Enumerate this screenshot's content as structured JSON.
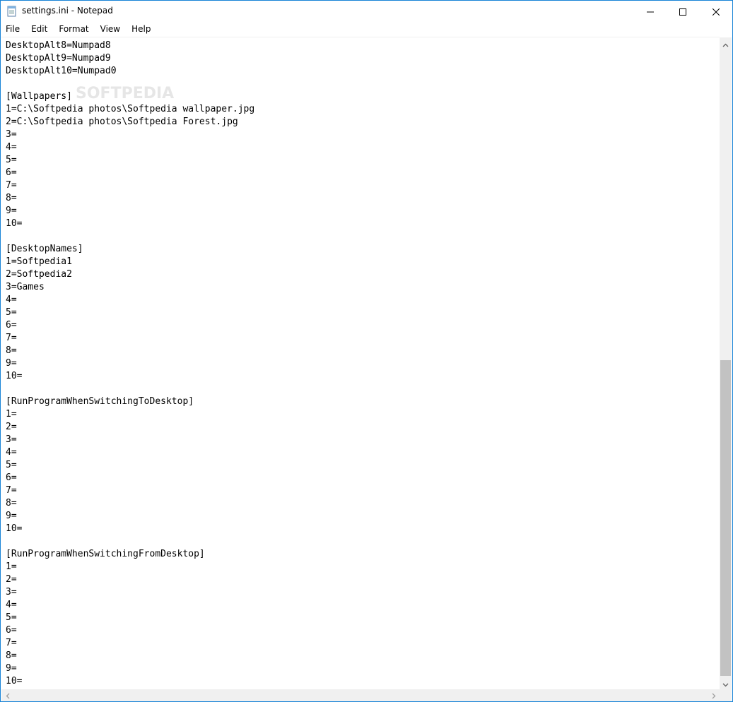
{
  "window": {
    "title": "settings.ini - Notepad",
    "accent_border": "#1883d7"
  },
  "title_buttons": {
    "minimize_icon": "minimize-icon",
    "maximize_icon": "maximize-icon",
    "close_icon": "close-icon"
  },
  "menu": {
    "items": [
      {
        "label": "File"
      },
      {
        "label": "Edit"
      },
      {
        "label": "Format"
      },
      {
        "label": "View"
      },
      {
        "label": "Help"
      }
    ]
  },
  "editor": {
    "lines": [
      "DesktopAlt8=Numpad8",
      "DesktopAlt9=Numpad9",
      "DesktopAlt10=Numpad0",
      "",
      "[Wallpapers]",
      "1=C:\\Softpedia photos\\Softpedia wallpaper.jpg",
      "2=C:\\Softpedia photos\\Softpedia Forest.jpg",
      "3=",
      "4=",
      "5=",
      "6=",
      "7=",
      "8=",
      "9=",
      "10=",
      "",
      "[DesktopNames]",
      "1=Softpedia1",
      "2=Softpedia2",
      "3=Games",
      "4=",
      "5=",
      "6=",
      "7=",
      "8=",
      "9=",
      "10=",
      "",
      "[RunProgramWhenSwitchingToDesktop]",
      "1=",
      "2=",
      "3=",
      "4=",
      "5=",
      "6=",
      "7=",
      "8=",
      "9=",
      "10=",
      "",
      "[RunProgramWhenSwitchingFromDesktop]",
      "1=",
      "2=",
      "3=",
      "4=",
      "5=",
      "6=",
      "7=",
      "8=",
      "9=",
      "10="
    ]
  },
  "watermark": {
    "text": "SOFTPEDIA"
  },
  "scrollbar": {
    "vertical_position_fraction": 0.49
  }
}
